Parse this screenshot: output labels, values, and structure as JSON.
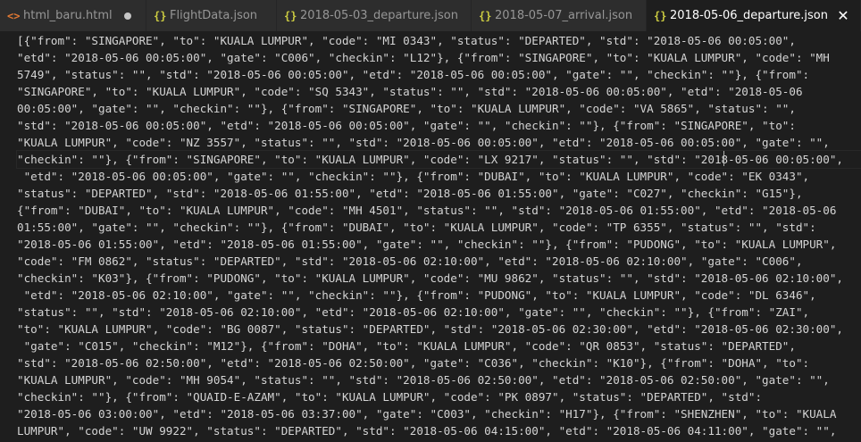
{
  "tabs": [
    {
      "icon": "<>",
      "label": "html_baru.html",
      "state": "modified"
    },
    {
      "icon": "{}",
      "label": "FlightData.json",
      "state": ""
    },
    {
      "icon": "{}",
      "label": "2018-05-03_departure.json",
      "state": ""
    },
    {
      "icon": "{}",
      "label": "2018-05-07_arrival.json",
      "state": ""
    },
    {
      "icon": "{}",
      "label": "2018-05-06_departure.json",
      "state": "active",
      "close": "✕"
    }
  ],
  "editor": {
    "lines": [
      "[{\"from\": \"SINGAPORE\", \"to\": \"KUALA LUMPUR\", \"code\": \"MI 0343\", \"status\": \"DEPARTED\", \"std\": \"2018-05-06 00:05:00\",",
      "\"etd\": \"2018-05-06 00:05:00\", \"gate\": \"C006\", \"checkin\": \"L12\"}, {\"from\": \"SINGAPORE\", \"to\": \"KUALA LUMPUR\", \"code\": \"MH",
      "5749\", \"status\": \"\", \"std\": \"2018-05-06 00:05:00\", \"etd\": \"2018-05-06 00:05:00\", \"gate\": \"\", \"checkin\": \"\"}, {\"from\":",
      "\"SINGAPORE\", \"to\": \"KUALA LUMPUR\", \"code\": \"SQ 5343\", \"status\": \"\", \"std\": \"2018-05-06 00:05:00\", \"etd\": \"2018-05-06",
      "00:05:00\", \"gate\": \"\", \"checkin\": \"\"}, {\"from\": \"SINGAPORE\", \"to\": \"KUALA LUMPUR\", \"code\": \"VA 5865\", \"status\": \"\",",
      "\"std\": \"2018-05-06 00:05:00\", \"etd\": \"2018-05-06 00:05:00\", \"gate\": \"\", \"checkin\": \"\"}, {\"from\": \"SINGAPORE\", \"to\":",
      "\"KUALA LUMPUR\", \"code\": \"NZ 3557\", \"status\": \"\", \"std\": \"2018-05-06 00:05:00\", \"etd\": \"2018-05-06 00:05:00\", \"gate\": \"\",",
      "\"checkin\": \"\"}, {\"from\": \"SINGAPORE\", \"to\": \"KUALA LUMPUR\", \"code\": \"LX 9217\", \"status\": \"\", \"std\": \"2018-05-06 00:05:00\",",
      " \"etd\": \"2018-05-06 00:05:00\", \"gate\": \"\", \"checkin\": \"\"}, {\"from\": \"DUBAI\", \"to\": \"KUALA LUMPUR\", \"code\": \"EK 0343\",",
      "\"status\": \"DEPARTED\", \"std\": \"2018-05-06 01:55:00\", \"etd\": \"2018-05-06 01:55:00\", \"gate\": \"C027\", \"checkin\": \"G15\"},",
      "{\"from\": \"DUBAI\", \"to\": \"KUALA LUMPUR\", \"code\": \"MH 4501\", \"status\": \"\", \"std\": \"2018-05-06 01:55:00\", \"etd\": \"2018-05-06",
      "01:55:00\", \"gate\": \"\", \"checkin\": \"\"}, {\"from\": \"DUBAI\", \"to\": \"KUALA LUMPUR\", \"code\": \"TP 6355\", \"status\": \"\", \"std\":",
      "\"2018-05-06 01:55:00\", \"etd\": \"2018-05-06 01:55:00\", \"gate\": \"\", \"checkin\": \"\"}, {\"from\": \"PUDONG\", \"to\": \"KUALA LUMPUR\",",
      "\"code\": \"FM 0862\", \"status\": \"DEPARTED\", \"std\": \"2018-05-06 02:10:00\", \"etd\": \"2018-05-06 02:10:00\", \"gate\": \"C006\",",
      "\"checkin\": \"K03\"}, {\"from\": \"PUDONG\", \"to\": \"KUALA LUMPUR\", \"code\": \"MU 9862\", \"status\": \"\", \"std\": \"2018-05-06 02:10:00\",",
      " \"etd\": \"2018-05-06 02:10:00\", \"gate\": \"\", \"checkin\": \"\"}, {\"from\": \"PUDONG\", \"to\": \"KUALA LUMPUR\", \"code\": \"DL 6346\",",
      "\"status\": \"\", \"std\": \"2018-05-06 02:10:00\", \"etd\": \"2018-05-06 02:10:00\", \"gate\": \"\", \"checkin\": \"\"}, {\"from\": \"ZAI\",",
      "\"to\": \"KUALA LUMPUR\", \"code\": \"BG 0087\", \"status\": \"DEPARTED\", \"std\": \"2018-05-06 02:30:00\", \"etd\": \"2018-05-06 02:30:00\",",
      " \"gate\": \"C015\", \"checkin\": \"M12\"}, {\"from\": \"DOHA\", \"to\": \"KUALA LUMPUR\", \"code\": \"QR 0853\", \"status\": \"DEPARTED\",",
      "\"std\": \"2018-05-06 02:50:00\", \"etd\": \"2018-05-06 02:50:00\", \"gate\": \"C036\", \"checkin\": \"K10\"}, {\"from\": \"DOHA\", \"to\":",
      "\"KUALA LUMPUR\", \"code\": \"MH 9054\", \"status\": \"\", \"std\": \"2018-05-06 02:50:00\", \"etd\": \"2018-05-06 02:50:00\", \"gate\": \"\",",
      "\"checkin\": \"\"}, {\"from\": \"QUAID-E-AZAM\", \"to\": \"KUALA LUMPUR\", \"code\": \"PK 0897\", \"status\": \"DEPARTED\", \"std\":",
      "\"2018-05-06 03:00:00\", \"etd\": \"2018-05-06 03:37:00\", \"gate\": \"C003\", \"checkin\": \"H17\"}, {\"from\": \"SHENZHEN\", \"to\": \"KUALA",
      "LUMPUR\", \"code\": \"UW 9922\", \"status\": \"DEPARTED\", \"std\": \"2018-05-06 04:15:00\", \"etd\": \"2018-05-06 04:11:00\", \"gate\": \"\","
    ]
  }
}
